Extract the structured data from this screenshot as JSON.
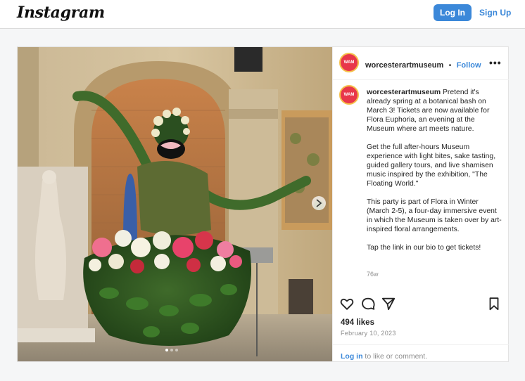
{
  "topbar": {
    "logo": "Instagram",
    "login_label": "Log In",
    "signup_label": "Sign Up"
  },
  "post": {
    "username": "worcesterartmuseum",
    "separator": "•",
    "follow_label": "Follow",
    "more_label": "•••",
    "caption_paragraphs": [
      "Pretend it's already spring at a botanical bash on March 3! Tickets are now available for Flora Euphoria, an evening at the Museum where art meets nature.",
      "Get the full after-hours Museum experience with light bites, sake tasting, guided gallery tours, and live shamisen music inspired by the exhibition, \"The Floating World.\"",
      "This party is part of Flora in Winter (March 2-5), a four-day immersive event in which the Museum is taken over by art-inspired floral arrangements.",
      "Tap the link in our bio to get tickets!"
    ],
    "time_ago": "76w",
    "likes": "494 likes",
    "date": "February 10, 2023",
    "footer_login": "Log in",
    "footer_text": " to like or comment.",
    "carousel_pages": 3,
    "carousel_active": 1
  },
  "icons": [
    "heart-icon",
    "comment-icon",
    "share-icon",
    "bookmark-icon",
    "next-arrow-icon",
    "more-options-icon"
  ],
  "colors": {
    "accent": "#3b88d9",
    "avatar": "#e8374a",
    "muted": "#8e8e8e"
  }
}
